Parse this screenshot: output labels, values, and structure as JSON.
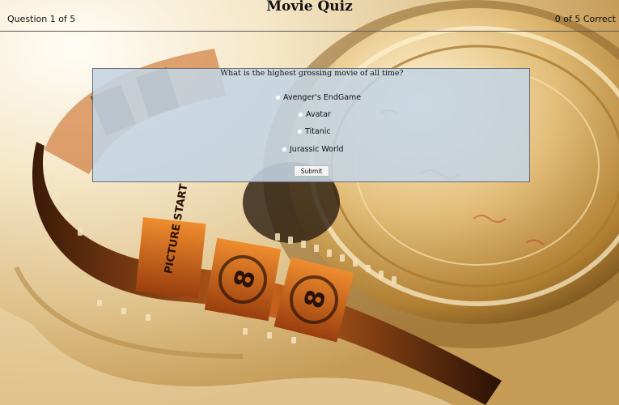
{
  "header": {
    "title": "Movie Quiz",
    "question_counter": "Question 1 of 5",
    "score": "0 of 5 Correct"
  },
  "quiz": {
    "question": "What is the highest grossing movie of all time?",
    "options": [
      {
        "label": "Avenger's EndGame"
      },
      {
        "label": "Avatar"
      },
      {
        "label": "Titanic"
      },
      {
        "label": "Jurassic World"
      }
    ],
    "submit_label": "Submit"
  },
  "background": {
    "leader_text": "PICTURE START",
    "frame_number": "8"
  },
  "colors": {
    "panel": "#c4d4e2",
    "panel_border": "#6b6f74",
    "header_rule": "#5a5a5a",
    "reel_gold": "#c99a48",
    "film_dark": "#1a0f08",
    "film_orange": "#d9731f"
  }
}
